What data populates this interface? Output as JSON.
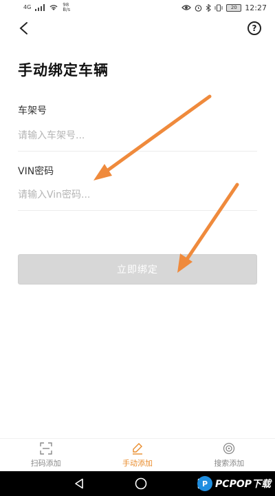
{
  "status_bar": {
    "signal": "4G",
    "speed_value": "98",
    "speed_unit": "B/s",
    "battery": "20",
    "time": "12:27"
  },
  "header": {
    "title": "手动绑定车辆"
  },
  "form": {
    "frame_label": "车架号",
    "frame_placeholder": "请输入车架号...",
    "frame_value": "",
    "vin_label": "VIN密码",
    "vin_placeholder": "请输入Vin密码...",
    "vin_value": "",
    "submit_label": "立即绑定"
  },
  "tabs": [
    {
      "label": "扫码添加",
      "icon": "scan-icon",
      "active": false
    },
    {
      "label": "手动添加",
      "icon": "edit-icon",
      "active": true
    },
    {
      "label": "搜索添加",
      "icon": "radar-icon",
      "active": false
    }
  ],
  "watermark": {
    "logo": "P",
    "text": "PCPOP下载"
  },
  "colors": {
    "accent": "#e98b2a",
    "arrow": "#ef8a3c",
    "button_disabled": "#d7d7d7"
  }
}
